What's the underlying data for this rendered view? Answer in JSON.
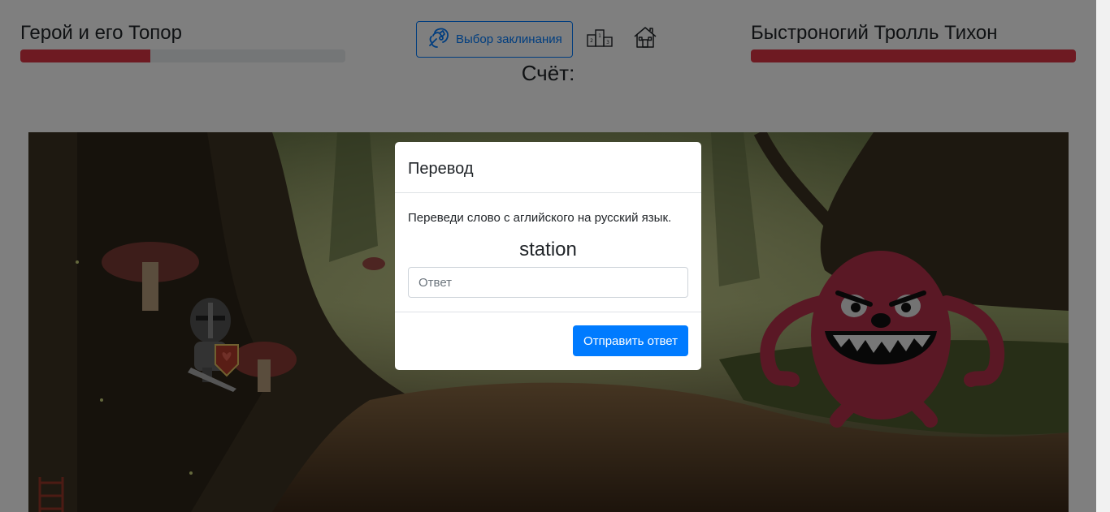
{
  "hero": {
    "name": "Герой и его Топор",
    "health_fraction": 0.4
  },
  "enemy": {
    "name": "Быстроногий Тролль Тихон",
    "health_fraction": 1.0
  },
  "toolbar": {
    "spell_button_label": "Выбор заклинания",
    "spell_icon": "spell-icon",
    "leaderboard_icon": "podium-icon",
    "home_icon": "home-icon"
  },
  "score": {
    "label": "Счёт:"
  },
  "modal": {
    "title": "Перевод",
    "instruction": "Переведи слово с аглийского на русский язык.",
    "word": "station",
    "answer_placeholder": "Ответ",
    "answer_value": "",
    "submit_label": "Отправить ответ"
  },
  "colors": {
    "health_bar": "#dc3545",
    "health_track": "#e9ecef",
    "primary": "#007bff",
    "troll_body": "#b5304b"
  }
}
